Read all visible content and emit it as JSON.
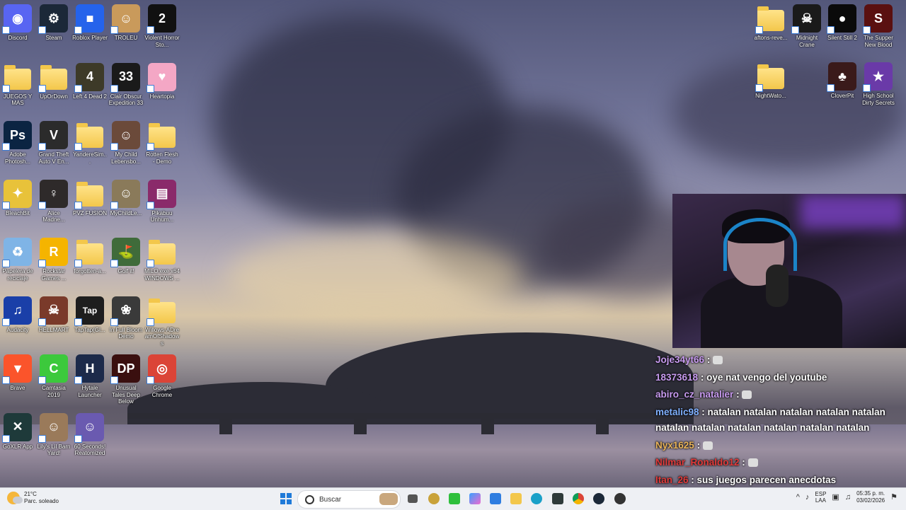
{
  "desktop": {
    "icons": [
      {
        "label": "Discord",
        "icon": "discord-icon",
        "color": "#5865f2",
        "glyph": "◉"
      },
      {
        "label": "Steam",
        "icon": "steam-icon",
        "color": "#1b2838",
        "glyph": "⚙"
      },
      {
        "label": "Roblox Player",
        "icon": "roblox-icon",
        "color": "#2563eb",
        "glyph": "■"
      },
      {
        "label": "TROLEU",
        "icon": "troll-face-icon",
        "color": "#c99a5b",
        "glyph": "☺"
      },
      {
        "label": "Violent Horror Sto...",
        "icon": "violent-horror-icon",
        "color": "#111",
        "glyph": "2"
      },
      {
        "label": "JUEGOS Y MAS",
        "icon": "folder-icon",
        "folder": true
      },
      {
        "label": "UpOrDown",
        "icon": "folder-icon",
        "folder": true
      },
      {
        "label": "Left 4 Dead 2",
        "icon": "left4dead-icon",
        "color": "#3d3a28",
        "glyph": "4"
      },
      {
        "label": "Clair Obscur Expedition 33",
        "icon": "clair-obscur-icon",
        "color": "#1a1a1a",
        "glyph": "33"
      },
      {
        "label": "Heartopia",
        "icon": "heartopia-icon",
        "color": "#f4a7c5",
        "glyph": "♥"
      },
      {
        "label": "Adobe Photosh...",
        "icon": "photoshop-icon",
        "color": "#0b2442",
        "glyph": "Ps"
      },
      {
        "label": "Grand Theft Auto V En...",
        "icon": "gta-v-icon",
        "color": "#2b2b2b",
        "glyph": "V"
      },
      {
        "label": "YandereSim...",
        "icon": "folder-icon",
        "folder": true
      },
      {
        "label": "My Child Lebensbo...",
        "icon": "my-child-icon",
        "color": "#6b4a3a",
        "glyph": "☺"
      },
      {
        "label": "Rotten Flesh - Demo",
        "icon": "folder-icon",
        "folder": true
      },
      {
        "label": "BleachBit",
        "icon": "bleachbit-icon",
        "color": "#e8c23a",
        "glyph": "✦"
      },
      {
        "label": "Alice Madne...",
        "icon": "alice-madness-icon",
        "color": "#2e2a2a",
        "glyph": "♀"
      },
      {
        "label": "PVZ FUSION",
        "icon": "folder-icon",
        "folder": true
      },
      {
        "label": "MyChildLe...",
        "icon": "mychild-folder-icon",
        "color": "#8a7a5a",
        "glyph": "☺"
      },
      {
        "label": "Pikabuu Unhum...",
        "icon": "winrar-icon",
        "color": "#8a2a6a",
        "glyph": "▤"
      },
      {
        "label": "Papelera de reciclaje",
        "icon": "recycle-bin-icon",
        "color": "#7fb4e6",
        "glyph": "♻"
      },
      {
        "label": "Rockstar Games ...",
        "icon": "rockstar-icon",
        "color": "#f5b400",
        "glyph": "R"
      },
      {
        "label": "forgotten-a...",
        "icon": "folder-icon",
        "folder": true
      },
      {
        "label": "Golf it!",
        "icon": "golf-it-icon",
        "color": "#3f6b3a",
        "glyph": "⛳"
      },
      {
        "label": "MILO.exe x64 WINDOWS ...",
        "icon": "folder-icon",
        "folder": true
      },
      {
        "label": "Audacity",
        "icon": "audacity-icon",
        "color": "#1a3fa8",
        "glyph": "♫"
      },
      {
        "label": "HELLMART",
        "icon": "hellmart-icon",
        "color": "#7a3a2a",
        "glyph": "☠"
      },
      {
        "label": "TapTap(Gl...",
        "icon": "taptap-icon",
        "color": "#1e1e1e",
        "glyph": "Tap"
      },
      {
        "label": "In Full Bloom Demo",
        "icon": "in-full-bloom-icon",
        "color": "#3a3a3a",
        "glyph": "❀"
      },
      {
        "label": "Willows-ADre amOfShadow s",
        "icon": "folder-icon",
        "folder": true
      },
      {
        "label": "Brave",
        "icon": "brave-icon",
        "color": "#fb542b",
        "glyph": "▼"
      },
      {
        "label": "Camtasia 2019",
        "icon": "camtasia-icon",
        "color": "#3cc93c",
        "glyph": "C"
      },
      {
        "label": "Hytale Launcher",
        "icon": "hytale-icon",
        "color": "#1c2a4a",
        "glyph": "H"
      },
      {
        "label": "Unusual Tales Deep Below",
        "icon": "unusual-tales-icon",
        "color": "#3a0f0f",
        "glyph": "DP"
      },
      {
        "label": "Google Chrome",
        "icon": "chrome-icon",
        "color": "#db4437",
        "glyph": "◎"
      },
      {
        "label": "GoXLR App",
        "icon": "goxlr-icon",
        "color": "#1e3a3a",
        "glyph": "✕"
      },
      {
        "label": "Lily's Lil Barn Yard!",
        "icon": "lilys-barn-icon",
        "color": "#9a7a5a",
        "glyph": "☺"
      },
      {
        "label": "60 Seconds! Reatomized",
        "icon": "sixty-seconds-icon",
        "color": "#6a5ab0",
        "glyph": "☺"
      }
    ],
    "right_icons": [
      {
        "label": "aftons-reve...",
        "icon": "folder-icon",
        "folder": true
      },
      {
        "label": "Midnight Crane",
        "icon": "midnight-crane-icon",
        "color": "#1a1a1a",
        "glyph": "☠"
      },
      {
        "label": "Silent Still 2",
        "icon": "silent-still-icon",
        "color": "#0a0a0a",
        "glyph": "●"
      },
      {
        "label": "The Supper New Blood",
        "icon": "the-supper-icon",
        "color": "#5a1010",
        "glyph": "S"
      },
      {
        "label": "NightWato...",
        "icon": "folder-icon",
        "folder": true
      },
      {
        "label": "CloverPit",
        "icon": "cloverpit-icon",
        "color": "#3a1a1a",
        "glyph": "♣"
      },
      {
        "label": "High School Dirty Secrets",
        "icon": "high-school-icon",
        "color": "#6a3aa8",
        "glyph": "★"
      }
    ]
  },
  "chat": {
    "messages": [
      {
        "user": "Joje34yt66",
        "color": "#c89bf0",
        "text": "",
        "emote": true
      },
      {
        "user": "18373618",
        "color": "#c89bf0",
        "text": "oye nat vengo del youtube"
      },
      {
        "user": "abiro_cz_natalier",
        "color": "#c89bf0",
        "text": "",
        "emote": true
      },
      {
        "user": "metalic98",
        "color": "#7fb0ff",
        "text": "natalan natalan natalan natalan natalan natalan natalan natalan natalan natalan natalan"
      },
      {
        "user": "Nyx1625",
        "color": "#e8b35a",
        "text": "",
        "emote": true
      },
      {
        "user": "Nilmar_Ronaldo12",
        "color": "#e23b3b",
        "text": "",
        "emote": true
      },
      {
        "user": "Itan_26",
        "color": "#e23b3b",
        "text": "sus juegos parecen anecdotas"
      }
    ]
  },
  "taskbar": {
    "weather_temp": "21°C",
    "weather_desc": "Parc. soleado",
    "search_placeholder": "Buscar",
    "lang_top": "ESP",
    "lang_bottom": "LAA",
    "time": "05:35 p. m.",
    "date": "03/02/2026"
  }
}
